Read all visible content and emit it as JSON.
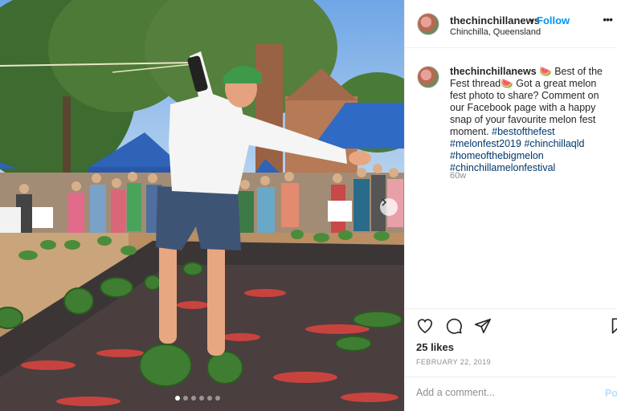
{
  "post": {
    "username": "thechinchillanews",
    "separator": "•",
    "follow_label": "Follow",
    "location": "Chinchilla, Queensland",
    "more_icon": "more-dots-icon"
  },
  "caption": {
    "username": "thechinchillanews",
    "emoji": "🍉",
    "text_1": " Best of the Fest thread",
    "text_2": " Got a great melon fest photo to share? Comment on our Facebook page with a happy snap of your favourite melon fest moment.",
    "hashtags": [
      "#bestofthefest",
      "#melonfest2019",
      "#chinchillaqld",
      "#homeofthebigmelon",
      "#chinchillamelonfestival"
    ],
    "time_ago": "60w"
  },
  "actions": {
    "icons": [
      "heart-icon",
      "comment-icon",
      "share-icon",
      "bookmark-icon"
    ],
    "likes": "25 likes",
    "date": "FEBRUARY 22, 2019"
  },
  "comment": {
    "placeholder": "Add a comment...",
    "post_label": "Post"
  },
  "carousel": {
    "slide_count": 6,
    "active_index": 0
  },
  "colors": {
    "link_blue": "#0095f6",
    "hashtag": "#00376b",
    "muted": "#8e8e8e",
    "border": "#efefef"
  }
}
